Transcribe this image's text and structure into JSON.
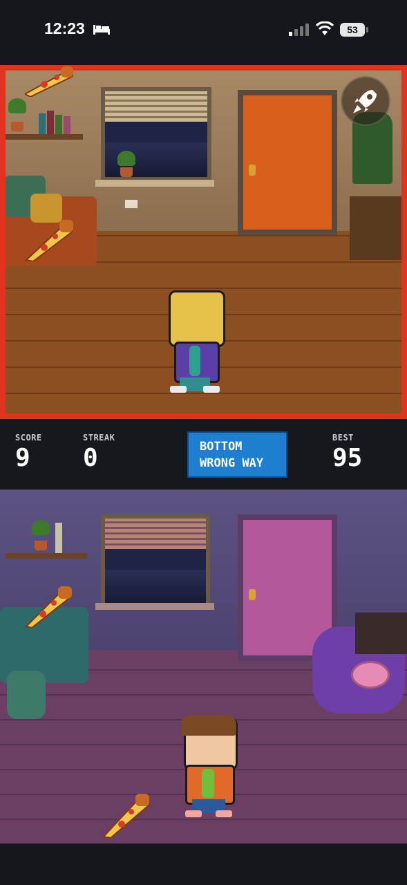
{
  "status_bar": {
    "time": "12:23",
    "battery_level": "53",
    "icons": [
      "bed-icon",
      "cellular-signal-icon",
      "wifi-icon",
      "battery-icon"
    ]
  },
  "top_room": {
    "theme": "orange-living-room",
    "state": "wrong",
    "border_color": "#e0331f",
    "items": [
      "window",
      "door",
      "bookshelf",
      "sofa",
      "coat-rack",
      "shoe-rack",
      "pizza",
      "character-panicking"
    ]
  },
  "bottom_room": {
    "theme": "purple-bedroom",
    "items": [
      "window",
      "door",
      "shelf",
      "bed",
      "beanie-chair",
      "donut",
      "backpack",
      "pizza",
      "character-happy"
    ]
  },
  "scoreboard": {
    "score_label": "SCORE",
    "score_value": "9",
    "streak_label": "STREAK",
    "streak_value": "0",
    "message_line1": "BOTTOM",
    "message_line2": "WRONG WAY",
    "best_label": "BEST",
    "best_value": "95"
  },
  "controls": {
    "boost_icon": "rocket-icon"
  },
  "colors": {
    "accent_blue": "#1e7fd0",
    "danger_red": "#e0331f",
    "board_bg": "#15181d"
  }
}
